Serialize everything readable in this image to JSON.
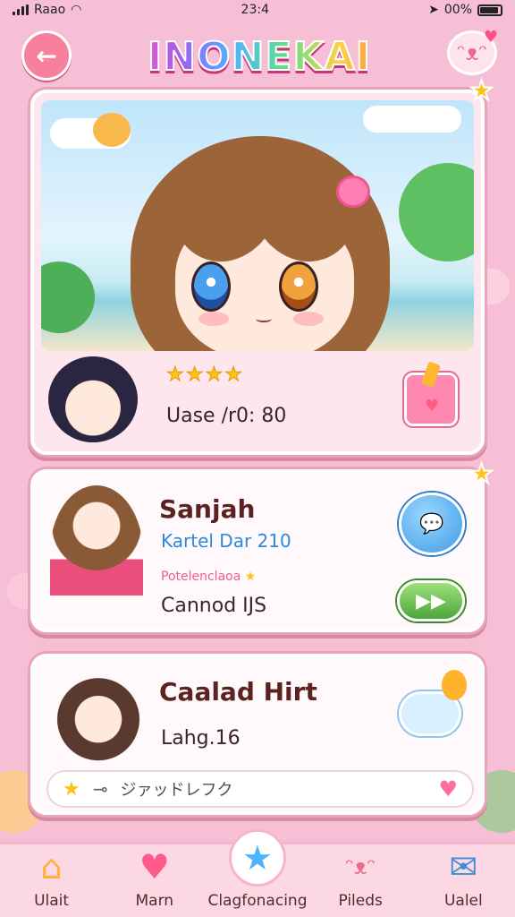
{
  "status_bar": {
    "carrier": "Raao",
    "time": "23:4",
    "battery": "00%"
  },
  "header": {
    "title": "INONEKAI"
  },
  "hero": {
    "stats": "Uase /r0: 80"
  },
  "cards": [
    {
      "name": "Sanjah",
      "subtitle": "Kartel Dar 210",
      "tag": "Potelenclaoa",
      "description": "Cannod IJS"
    },
    {
      "name": "Caalad Hirt",
      "description": "Lahg.16"
    }
  ],
  "search": {
    "label": "ジァッドレフク"
  },
  "nav": [
    {
      "label": "Ulait",
      "icon": "house-icon"
    },
    {
      "label": "Marn",
      "icon": "heart-icon"
    },
    {
      "label": "Clagfonacing",
      "icon": "star-icon"
    },
    {
      "label": "Pileds",
      "icon": "bear-icon"
    },
    {
      "label": "Ualel",
      "icon": "mailbox-icon"
    }
  ],
  "colors": {
    "background": "#f7bfd6",
    "accent_pink": "#ff5fa8",
    "star_yellow": "#ffc21a",
    "button_blue": "#3f9ae8",
    "button_green": "#4ca63a"
  }
}
